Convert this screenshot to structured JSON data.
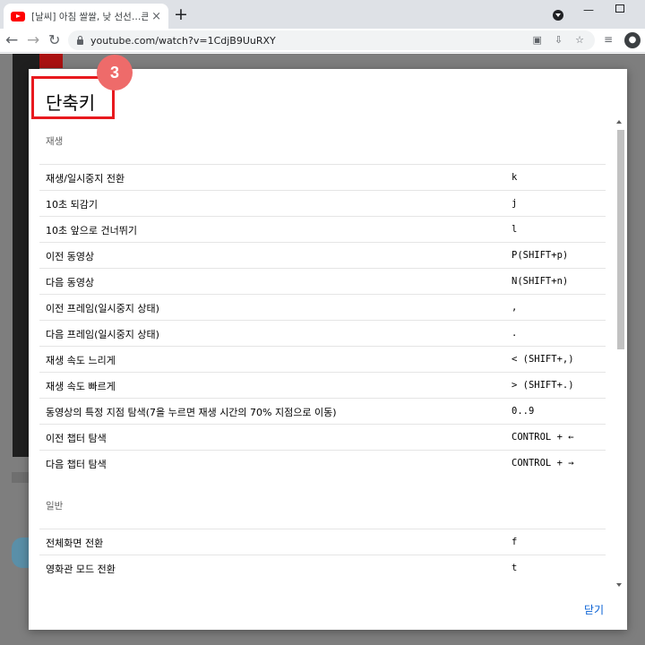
{
  "browser": {
    "tab_title": "[날씨] 아침 쌀쌀, 낮 선선…큰 일",
    "tab_close": "×",
    "new_tab": "+",
    "url": "youtube.com/watch?v=1CdjB9UuRXY"
  },
  "dialog": {
    "title": "단축키",
    "step_badge": "3",
    "close_label": "닫기",
    "sections": [
      {
        "heading": "재생",
        "rows": [
          {
            "label": "재생/일시중지 전환",
            "key": "k"
          },
          {
            "label": "10초 되감기",
            "key": "j"
          },
          {
            "label": "10초 앞으로 건너뛰기",
            "key": "l"
          },
          {
            "label": "이전 동영상",
            "key": "P(SHIFT+p)"
          },
          {
            "label": "다음 동영상",
            "key": "N(SHIFT+n)"
          },
          {
            "label": "이전 프레임(일시중지 상태)",
            "key": ","
          },
          {
            "label": "다음 프레임(일시중지 상태)",
            "key": "."
          },
          {
            "label": "재생 속도 느리게",
            "key": "< (SHIFT+,)"
          },
          {
            "label": "재생 속도 빠르게",
            "key": "> (SHIFT+.)"
          },
          {
            "label": "동영상의 특정 지점 탐색(7을 누르면 재생 시간의 70% 지점으로 이동)",
            "key": "0..9"
          },
          {
            "label": "이전 챕터 탐색",
            "key": "CONTROL + ←"
          },
          {
            "label": "다음 챕터 탐색",
            "key": "CONTROL + →"
          }
        ]
      },
      {
        "heading": "일반",
        "rows": [
          {
            "label": "전체화면 전환",
            "key": "f"
          },
          {
            "label": "영화관 모드 전환",
            "key": "t"
          }
        ]
      }
    ]
  }
}
